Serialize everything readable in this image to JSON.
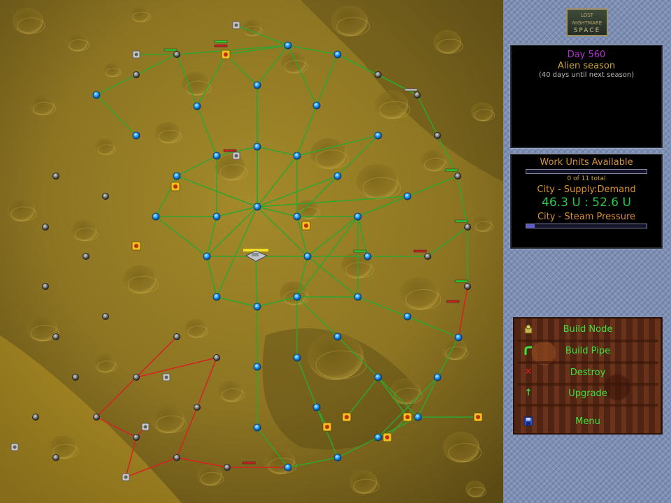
{
  "game_logo": {
    "line1": "LOST",
    "line2": "NIGHTMARE",
    "line3": "SPACE"
  },
  "season_panel": {
    "day": "Day 560",
    "season": "Alien season",
    "until": "(40 days until next season)"
  },
  "stats_panel": {
    "work_units_label": "Work Units Available",
    "work_units_fraction": 0,
    "work_units_total": "0 of 11 total",
    "supply_label": "City - Supply:Demand",
    "supply_value": "46.3 U : 52.6 U",
    "steam_label": "City - Steam Pressure",
    "steam_fraction": 0.07
  },
  "menu": {
    "build_node": "Build Node",
    "build_pipe": "Build Pipe",
    "destroy": "Destroy",
    "upgrade": "Upgrade",
    "menu": "Menu"
  },
  "icons": {
    "build_node": "node-crate-icon",
    "build_pipe": "pipe-icon",
    "destroy": "red-x-icon",
    "upgrade": "up-arrow-icon",
    "menu": "floppy-disk-icon"
  },
  "colors": {
    "pipe_ok": "#2fa52f",
    "pipe_broken": "#d42222",
    "node_active": "#2aa8ff",
    "accent_green": "#3de03d",
    "day_purple": "#b030d0"
  }
}
